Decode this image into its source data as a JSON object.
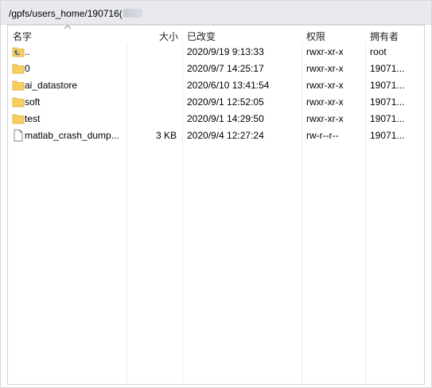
{
  "path_bar": {
    "path": "/gpfs/users_home/190716("
  },
  "columns": {
    "name": "名字",
    "size": "大小",
    "modified": "已改变",
    "permissions": "权限",
    "owner": "拥有者"
  },
  "files": [
    {
      "name": "..",
      "size": "",
      "modified": "2020/9/19 9:13:33",
      "permissions": "rwxr-xr-x",
      "owner": "root",
      "icon": "parent-folder-icon"
    },
    {
      "name": "0",
      "size": "",
      "modified": "2020/9/7 14:25:17",
      "permissions": "rwxr-xr-x",
      "owner": "19071...",
      "icon": "folder-icon"
    },
    {
      "name": "ai_datastore",
      "size": "",
      "modified": "2020/6/10 13:41:54",
      "permissions": "rwxr-xr-x",
      "owner": "19071...",
      "icon": "folder-icon"
    },
    {
      "name": "soft",
      "size": "",
      "modified": "2020/9/1 12:52:05",
      "permissions": "rwxr-xr-x",
      "owner": "19071...",
      "icon": "folder-icon"
    },
    {
      "name": "test",
      "size": "",
      "modified": "2020/9/1 14:29:50",
      "permissions": "rwxr-xr-x",
      "owner": "19071...",
      "icon": "folder-icon"
    },
    {
      "name": "matlab_crash_dump...",
      "size": "3 KB",
      "modified": "2020/9/4 12:27:24",
      "permissions": "rw-r--r--",
      "owner": "19071...",
      "icon": "file-icon"
    }
  ],
  "colors": {
    "folder": "#f7cf5f",
    "path_bar_bg": "#e8eaf0"
  }
}
